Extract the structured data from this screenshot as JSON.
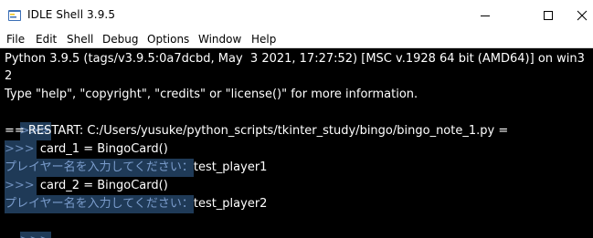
{
  "window": {
    "title": "IDLE Shell 3.9.5",
    "icon": "python-idle-icon",
    "controls": [
      "minimize",
      "maximize",
      "close"
    ]
  },
  "menu": {
    "items": [
      "File",
      "Edit",
      "Shell",
      "Debug",
      "Options",
      "Window",
      "Help"
    ]
  },
  "shell": {
    "banner_line1": "Python 3.9.5 (tags/v3.9.5:0a7dcbd, May  3 2021, 17:27:52) [MSC v.1928 64 bit (AMD64)] on win3",
    "banner_line2": "2",
    "banner_line3": "Type \"help\", \"copyright\", \"credits\" or \"license()\" for more information.",
    "prompt": ">>>",
    "restart_line": "== RESTART: C:/Users/yusuke/python_scripts/tkinter_study/bingo/bingo_note_1.py =",
    "cmd1": " card_1 = BingoCard()",
    "input_label1": "プレイヤー名を入力してください：",
    "input_value1": "test_player1",
    "cmd2": " card_2 = BingoCard()",
    "input_label2": "プレイヤー名を入力してください：",
    "input_value2": "test_player2"
  },
  "colors": {
    "background": "#000000",
    "text": "#ffffff",
    "prompt_bg": "#1f3a57",
    "prompt_fg": "#6f8fbd"
  }
}
